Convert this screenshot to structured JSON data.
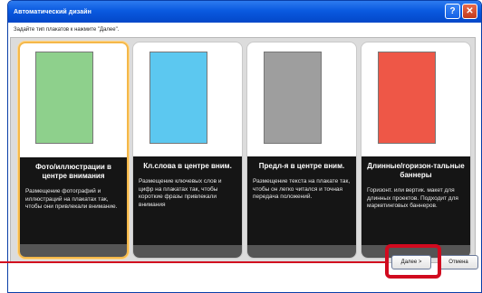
{
  "window": {
    "title": "Автоматический дизайн",
    "controls": {
      "help": "?",
      "close": "✕"
    }
  },
  "prompt": "Задайте тип плакатов к нажмите \"Далее\".",
  "cards": [
    {
      "title": "Фото/иллюстрации в центре внимания",
      "description": "Размещение фотографий и иллюстраций на плакатах так, чтобы они привлекали внимание.",
      "color": "#8ed08c",
      "selected": true
    },
    {
      "title": "Кл.слова в центре вним.",
      "description": "Размещение ключевых слов и цифр на плакатах так, чтобы короткие фразы привлекали внимания",
      "color": "#5cc8f0",
      "selected": false
    },
    {
      "title": "Предл-я в центре вним.",
      "description": "Размещение текста на плакате так, чтобы он легко читался и точная передача положений.",
      "color": "#9e9e9e",
      "selected": false
    },
    {
      "title": "Длинные/горизон-тальные баннеры",
      "description": "Горизонт. или вертик. макет для длинных проектов. Подходит для маркетинговых баннеров.",
      "color": "#ee5747",
      "selected": false
    }
  ],
  "buttons": {
    "next": "Далее >",
    "cancel": "Отмена"
  },
  "colors": {
    "highlight": "#d10a1f",
    "selection": "#f4b84a"
  }
}
